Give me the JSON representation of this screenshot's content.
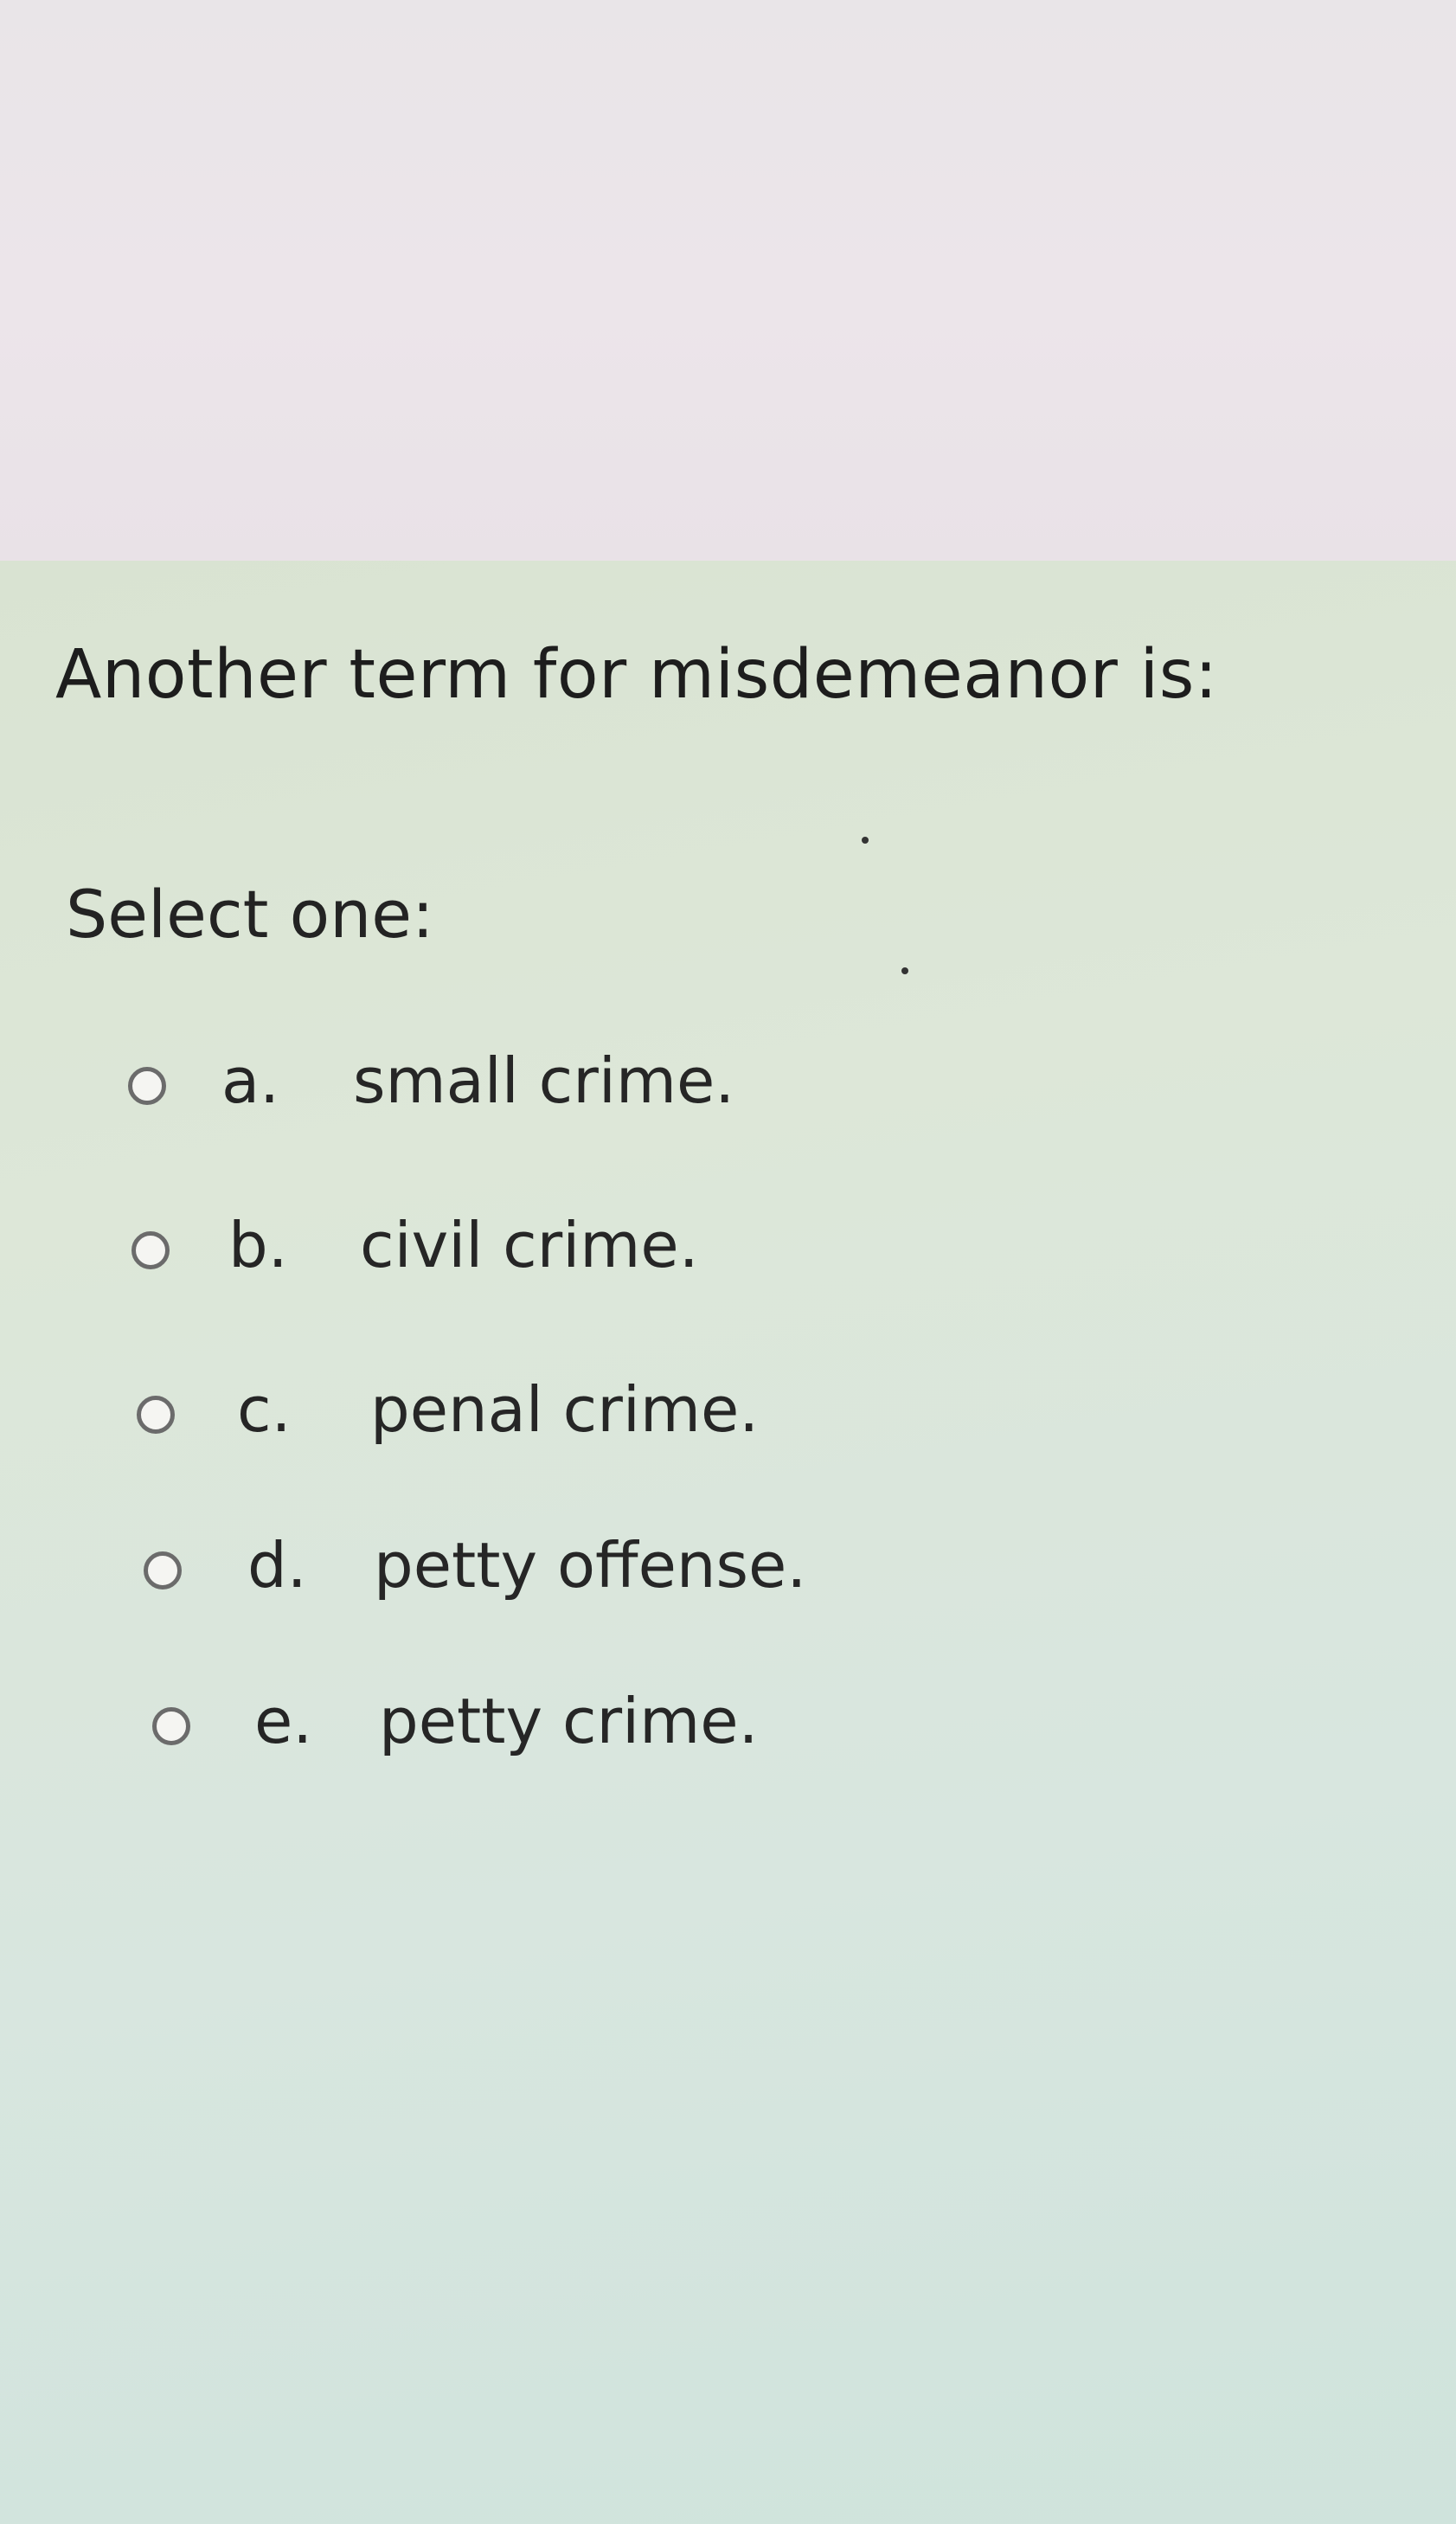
{
  "question": {
    "text": "Another term for misdemeanor is:"
  },
  "prompt": "Select one:",
  "options": [
    {
      "letter": "a.",
      "text": "small crime.",
      "selected": false
    },
    {
      "letter": "b.",
      "text": "civil crime.",
      "selected": false
    },
    {
      "letter": "c.",
      "text": "penal crime.",
      "selected": false
    },
    {
      "letter": "d.",
      "text": "petty offense.",
      "selected": false
    },
    {
      "letter": "e.",
      "text": "petty crime.",
      "selected": false
    }
  ]
}
